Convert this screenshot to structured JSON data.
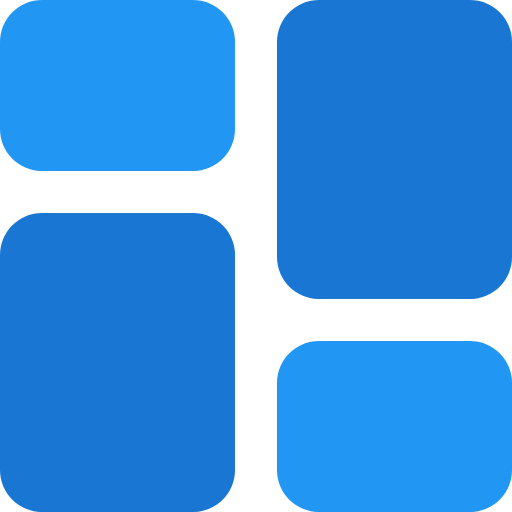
{
  "icon": {
    "name": "dashboard-layout-icon",
    "tiles": [
      {
        "name": "tile-top-left",
        "color": "#2196F3"
      },
      {
        "name": "tile-top-right",
        "color": "#1976D2"
      },
      {
        "name": "tile-bottom-left",
        "color": "#1976D2"
      },
      {
        "name": "tile-bottom-right",
        "color": "#2196F3"
      }
    ]
  }
}
